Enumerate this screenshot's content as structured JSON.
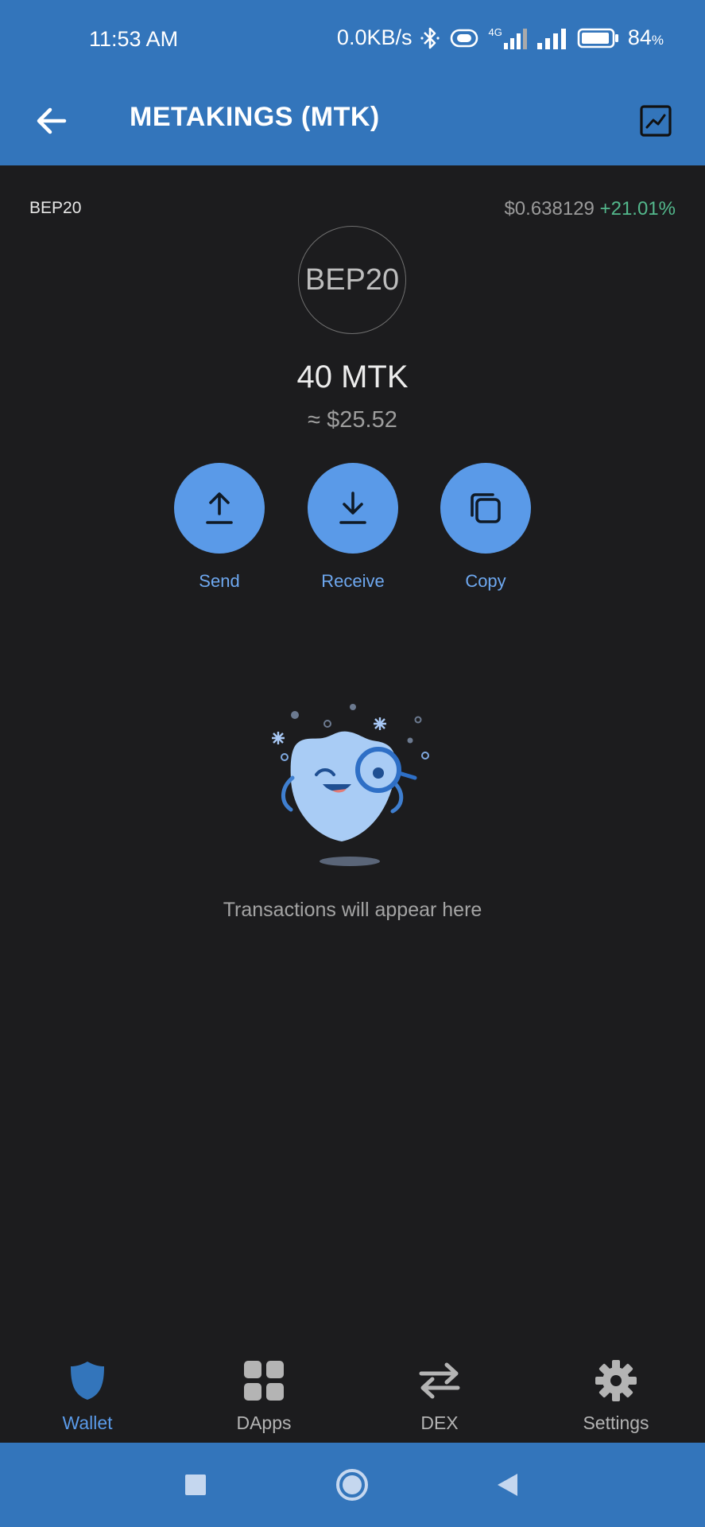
{
  "status_bar": {
    "time": "11:53 AM",
    "speed": "0.0KB/s",
    "battery": "84",
    "battery_unit": "%",
    "network": "4G"
  },
  "header": {
    "title": "METAKINGS (MTK)"
  },
  "token": {
    "network_tag": "BEP20",
    "price": "$0.638129",
    "change": "+21.01%",
    "logo_text": "BEP20",
    "balance": "40 MTK",
    "fiat_value": "≈ $25.52"
  },
  "actions": [
    {
      "label": "Send",
      "icon": "upload-icon"
    },
    {
      "label": "Receive",
      "icon": "download-icon"
    },
    {
      "label": "Copy",
      "icon": "copy-icon"
    }
  ],
  "empty_state": {
    "message": "Transactions will appear here"
  },
  "tabs": [
    {
      "label": "Wallet",
      "icon": "shield-icon",
      "active": true
    },
    {
      "label": "DApps",
      "icon": "grid-icon",
      "active": false
    },
    {
      "label": "DEX",
      "icon": "swap-arrows-icon",
      "active": false
    },
    {
      "label": "Settings",
      "icon": "gear-icon",
      "active": false
    }
  ],
  "colors": {
    "brand_blue": "#3375bb",
    "action_blue": "#5a9ae8",
    "positive_green": "#53b88c",
    "background": "#1c1c1e"
  }
}
